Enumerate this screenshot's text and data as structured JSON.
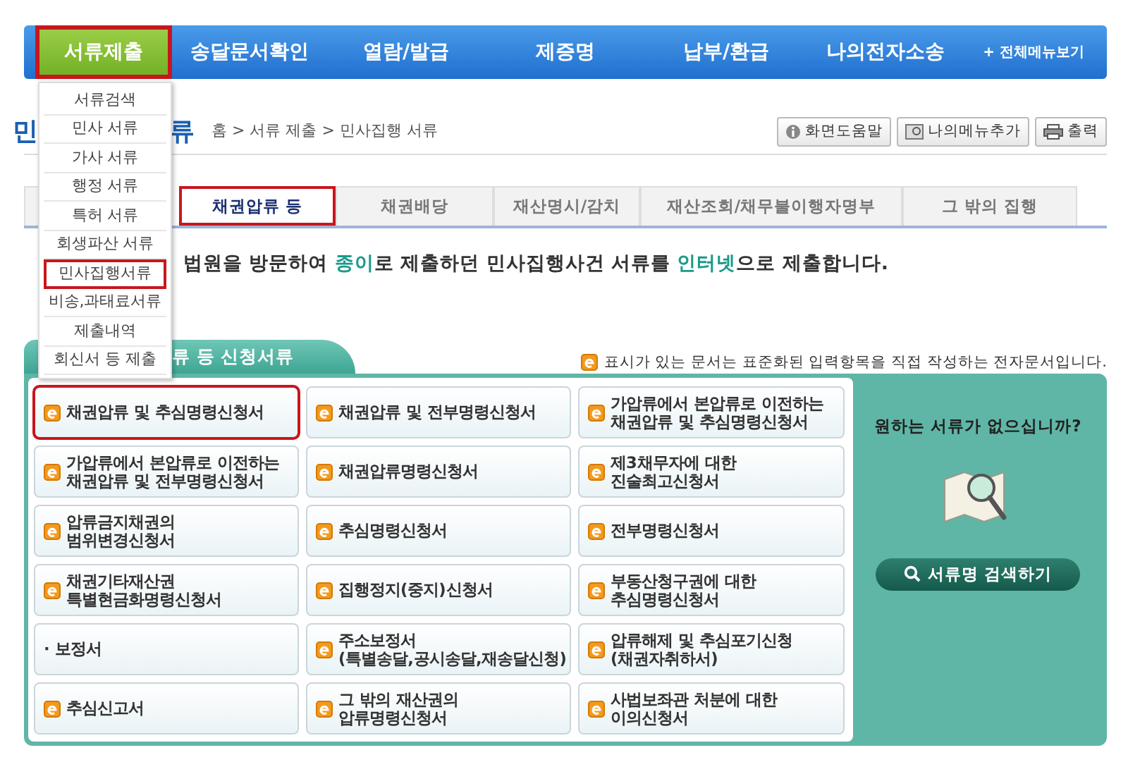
{
  "nav": {
    "items": [
      {
        "label": "서류제출",
        "selected": true
      },
      {
        "label": "송달문서확인",
        "selected": false
      },
      {
        "label": "열람/발급",
        "selected": false
      },
      {
        "label": "제증명",
        "selected": false
      },
      {
        "label": "납부/환급",
        "selected": false
      },
      {
        "label": "나의전자소송",
        "selected": false
      }
    ],
    "all_menu": {
      "icon": "+",
      "label": "전체메뉴보기"
    }
  },
  "dropdown": {
    "items": [
      {
        "label": "서류검색",
        "selected": false
      },
      {
        "label": "민사 서류",
        "selected": false
      },
      {
        "label": "가사 서류",
        "selected": false
      },
      {
        "label": "행정 서류",
        "selected": false
      },
      {
        "label": "특허 서류",
        "selected": false
      },
      {
        "label": "회생파산 서류",
        "selected": false
      },
      {
        "label": "민사집행서류",
        "selected": true
      },
      {
        "label": "비송,과태료서류",
        "selected": false
      },
      {
        "label": "제출내역",
        "selected": false
      },
      {
        "label": "회신서 등 제출",
        "selected": false
      }
    ]
  },
  "page": {
    "title_parts": [
      "민",
      "류"
    ],
    "breadcrumb": "홈 > 서류 제출 > 민사집행 서류",
    "tools": [
      {
        "label": "화면도움말",
        "kind": "help"
      },
      {
        "label": "나의메뉴추가",
        "kind": "bookmark"
      },
      {
        "label": "출력",
        "kind": "print"
      }
    ]
  },
  "tabs": [
    {
      "label": "채권압류 등",
      "selected": true
    },
    {
      "label": "채권배당",
      "selected": false
    },
    {
      "label": "재산명시/감치",
      "selected": false
    },
    {
      "label": "재산조회/채무불이행자명부",
      "selected": false
    },
    {
      "label": "그 밖의 집행",
      "selected": false
    }
  ],
  "intro": [
    {
      "text": "법원을 방문하여 ",
      "highlight": false
    },
    {
      "text": "종이",
      "highlight": true
    },
    {
      "text": "로 제출하던 민사집행사건 서류를 ",
      "highlight": false
    },
    {
      "text": "인터넷",
      "highlight": true
    },
    {
      "text": "으로 제출합니다.",
      "highlight": false
    }
  ],
  "panel": {
    "title": "류 등 신청서류",
    "note": "표시가 있는 문서는 표준화된 입력항목을 직접 작성하는 전자문서입니다.",
    "documents": [
      {
        "lines": [
          "채권압류 및 추심명령신청서"
        ],
        "kind": "eform",
        "selected": true
      },
      {
        "lines": [
          "채권압류 및 전부명령신청서"
        ],
        "kind": "eform",
        "selected": false
      },
      {
        "lines": [
          "가압류에서 본압류로 이전하는",
          "채권압류 및 추심명령신청서"
        ],
        "kind": "eform",
        "selected": false
      },
      {
        "lines": [
          "가압류에서 본압류로 이전하는",
          "채권압류 및 전부명령신청서"
        ],
        "kind": "eform",
        "selected": false
      },
      {
        "lines": [
          "채권압류명령신청서"
        ],
        "kind": "eform",
        "selected": false
      },
      {
        "lines": [
          "제3채무자에 대한",
          "진술최고신청서"
        ],
        "kind": "eform",
        "selected": false
      },
      {
        "lines": [
          "압류금지채권의",
          "범위변경신청서"
        ],
        "kind": "eform",
        "selected": false
      },
      {
        "lines": [
          "추심명령신청서"
        ],
        "kind": "eform",
        "selected": false
      },
      {
        "lines": [
          "전부명령신청서"
        ],
        "kind": "eform",
        "selected": false
      },
      {
        "lines": [
          "채권기타재산권",
          "특별현금화명령신청서"
        ],
        "kind": "eform",
        "selected": false
      },
      {
        "lines": [
          "집행정지(중지)신청서"
        ],
        "kind": "eform",
        "selected": false
      },
      {
        "lines": [
          "부동산청구권에 대한",
          "추심명령신청서"
        ],
        "kind": "eform",
        "selected": false
      },
      {
        "lines": [
          "· 보정서"
        ],
        "kind": "plain",
        "selected": false
      },
      {
        "lines": [
          "주소보정서",
          "(특별송달,공시송달,재송달신청)"
        ],
        "kind": "eform",
        "selected": false
      },
      {
        "lines": [
          "압류해제 및 추심포기신청",
          "(채권자취하서)"
        ],
        "kind": "eform",
        "selected": false
      },
      {
        "lines": [
          "추심신고서"
        ],
        "kind": "eform",
        "selected": false
      },
      {
        "lines": [
          "그 밖의 재산권의",
          "압류명령신청서"
        ],
        "kind": "eform",
        "selected": false
      },
      {
        "lines": [
          "사법보좌관 처분에 대한",
          "이의신청서"
        ],
        "kind": "eform",
        "selected": false
      }
    ],
    "side": {
      "question": "원하는 서류가 없으십니까?",
      "search_button": "서류명 검색하기"
    }
  }
}
